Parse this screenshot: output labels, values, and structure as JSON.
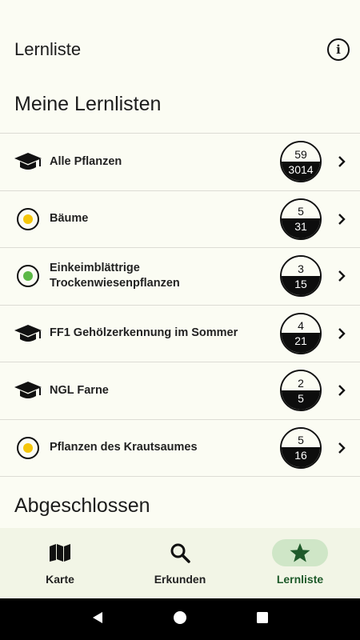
{
  "app_bar": {
    "title": "Lernliste",
    "info_icon": "info-icon"
  },
  "sections": {
    "mine": "Meine Lernlisten",
    "done": "Abgeschlossen"
  },
  "lists": [
    {
      "label": "Alle Pflanzen",
      "icon": "graduation-cap-icon",
      "top": "59",
      "bottom": "3014"
    },
    {
      "label": "Bäume",
      "icon": "dot-icon",
      "dot_color": "#f5c60a",
      "top": "5",
      "bottom": "31"
    },
    {
      "label": "Einkeimblättrige\nTrockenwiesenpflanzen",
      "icon": "dot-icon",
      "dot_color": "#5cb845",
      "top": "3",
      "bottom": "15"
    },
    {
      "label": "FF1 Gehölzerkennung im Sommer",
      "icon": "graduation-cap-icon",
      "top": "4",
      "bottom": "21"
    },
    {
      "label": "NGL Farne",
      "icon": "graduation-cap-icon",
      "top": "2",
      "bottom": "5"
    },
    {
      "label": "Pflanzen des Krautsaumes",
      "icon": "dot-icon",
      "dot_color": "#f5c60a",
      "top": "5",
      "bottom": "16"
    }
  ],
  "nav": [
    {
      "label": "Karte",
      "icon": "map-icon"
    },
    {
      "label": "Erkunden",
      "icon": "search-icon"
    },
    {
      "label": "Lernliste",
      "icon": "star-icon",
      "active": true
    }
  ],
  "colors": {
    "active_nav": "#1e5a2a",
    "active_pill": "#cfe6c7",
    "background": "#fbfcf3"
  }
}
